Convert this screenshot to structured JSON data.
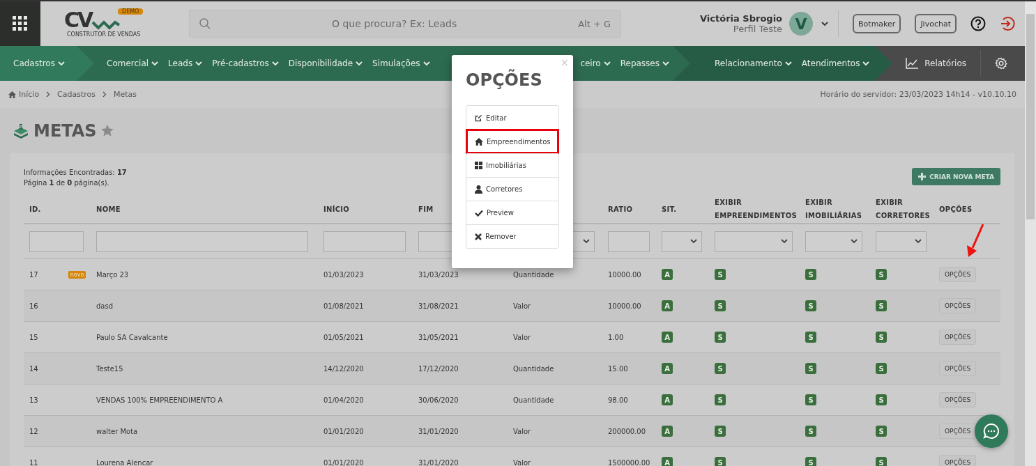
{
  "topbar": {
    "logo": {
      "letters": "CV",
      "badge": "DEMO",
      "tagline": "CONSTRUTOR DE VENDAS"
    },
    "search": {
      "placeholder": "O que procura? Ex: Leads",
      "shortcut": "Alt + G"
    },
    "user": {
      "name": "Victória Sbrogio",
      "profile": "Perfil Teste",
      "initial": "V"
    },
    "buttons": [
      "Botmaker",
      "Jivochat"
    ]
  },
  "nav": {
    "segments": [
      {
        "items": [
          "Cadastros"
        ]
      },
      {
        "items": [
          "Comercial",
          "Leads",
          "Pré-cadastros",
          "Disponibilidade",
          "Simulações"
        ],
        "items_right": [
          "ceiro",
          "Repasses"
        ]
      },
      {
        "items": [
          "Relacionamento",
          "Atendimentos"
        ]
      }
    ],
    "reports": "Relatórios"
  },
  "breadcrumbs": [
    "Início",
    "Cadastros",
    "Metas"
  ],
  "server_time": "Horário do servidor: 23/03/2023 14h14 - v10.10.10",
  "page_title": "METAS",
  "summary": [
    "Informações Encontradas: **17**",
    "Página **1** de **0** página(s)."
  ],
  "create_button": "CRIAR NOVA META",
  "table": {
    "columns": [
      {
        "label": "ID.",
        "kind": "text"
      },
      {
        "label": "NOME",
        "kind": "text"
      },
      {
        "label": "INÍCIO",
        "kind": "text"
      },
      {
        "label": "FIM",
        "kind": "text"
      },
      {
        "kind": "select"
      },
      {
        "label": "RATIO",
        "kind": "text"
      },
      {
        "label": "SIT.",
        "kind": "select"
      },
      {
        "label": "EXIBIR EMPREENDIMENTOS",
        "kind": "select"
      },
      {
        "label": "EXIBIR IMOBILIÁRIAS",
        "kind": "select"
      },
      {
        "label": "EXIBIR CORRETORES",
        "kind": "select"
      },
      {
        "label": "OPÇÕES",
        "kind": "none"
      }
    ],
    "rows": [
      {
        "id": "17",
        "badge": "novo",
        "name": "Março 23",
        "start": "01/03/2023",
        "end": "31/03/2023",
        "type": "Quantidade",
        "ratio": "10000.00",
        "sit": "A",
        "emp": "S",
        "imob": "S",
        "corr": "S",
        "action": "OPÇÕES"
      },
      {
        "id": "16",
        "name": "dasd",
        "start": "01/08/2021",
        "end": "31/08/2021",
        "type": "Valor",
        "ratio": "10000.00",
        "sit": "A",
        "emp": "S",
        "imob": "S",
        "corr": "S",
        "action": "OPÇÕES"
      },
      {
        "id": "15",
        "name": "Paulo SA Cavalcante",
        "start": "01/05/2021",
        "end": "31/05/2021",
        "type": "Valor",
        "ratio": "1.00",
        "sit": "A",
        "emp": "S",
        "imob": "S",
        "corr": "S",
        "action": "OPÇÕES"
      },
      {
        "id": "14",
        "name": "Teste15",
        "start": "14/12/2020",
        "end": "17/12/2020",
        "type": "Quantidade",
        "ratio": "15.00",
        "sit": "A",
        "emp": "S",
        "imob": "S",
        "corr": "S",
        "action": "OPÇÕES"
      },
      {
        "id": "13",
        "name": "VENDAS 100% EMPREENDIMENTO A",
        "start": "01/04/2020",
        "end": "30/06/2020",
        "type": "Quantidade",
        "ratio": "98.00",
        "sit": "A",
        "emp": "S",
        "imob": "S",
        "corr": "S",
        "action": "OPÇÕES"
      },
      {
        "id": "12",
        "name": "walter Mota",
        "start": "01/01/2020",
        "end": "31/01/2020",
        "type": "Valor",
        "ratio": "200000.00",
        "sit": "A",
        "emp": "S",
        "imob": "S",
        "corr": "S",
        "action": "OPÇÕES"
      },
      {
        "id": "11",
        "name": "Lourena Alencar",
        "start": "01/01/2020",
        "end": "31/01/2020",
        "type": "Valor",
        "ratio": "1500000.00",
        "sit": "A",
        "emp": "S",
        "imob": "S",
        "corr": "S",
        "action": "OPÇÕES"
      }
    ]
  },
  "modal": {
    "title": "OPÇÕES",
    "close": "×",
    "items": [
      {
        "label": "Editar",
        "highlighted": false
      },
      {
        "label": "Empreendimentos",
        "highlighted": true
      },
      {
        "label": "Imobiliárias",
        "highlighted": false
      },
      {
        "label": "Corretores",
        "highlighted": false
      },
      {
        "label": "Preview",
        "highlighted": false
      },
      {
        "label": "Remover",
        "highlighted": false
      }
    ]
  }
}
